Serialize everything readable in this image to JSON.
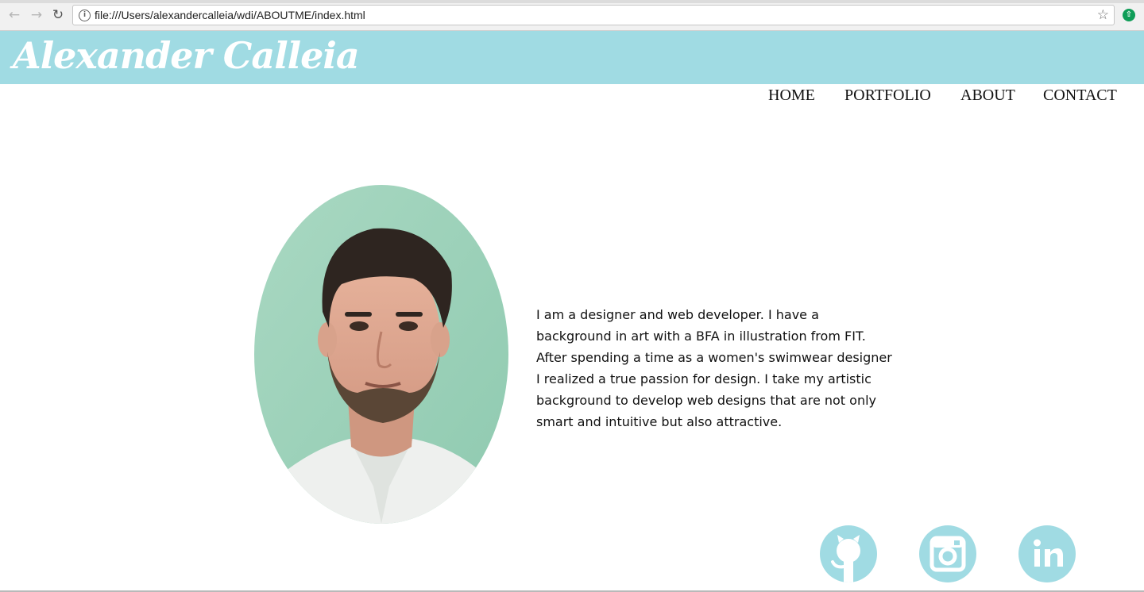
{
  "browser": {
    "url": "file:///Users/alexandercalleia/wdi/ABOUTME/index.html",
    "back_icon": "arrow-left-icon",
    "forward_icon": "arrow-right-icon",
    "reload_icon": "reload-icon",
    "info_icon": "info-icon",
    "bookmark_icon": "star-icon",
    "extension_icon": "update-arrow-icon"
  },
  "header": {
    "title": "Alexander Calleia",
    "background_color": "#a0dbe3"
  },
  "nav": {
    "items": [
      {
        "label": "HOME"
      },
      {
        "label": "PORTFOLIO"
      },
      {
        "label": "ABOUT"
      },
      {
        "label": "CONTACT"
      }
    ]
  },
  "about": {
    "portrait_alt": "portrait photo",
    "bio": "I am a designer and web developer. I have a background in art with a BFA in illustration from FIT. After spending a time as a women's swimwear designer I realized a true passion for design. I take my artistic background to develop web designs that are not only smart and intuitive but also attractive."
  },
  "social": {
    "links": [
      {
        "icon": "github-icon"
      },
      {
        "icon": "instagram-icon"
      },
      {
        "icon": "linkedin-icon"
      }
    ],
    "icon_color": "#a0dbe3"
  }
}
